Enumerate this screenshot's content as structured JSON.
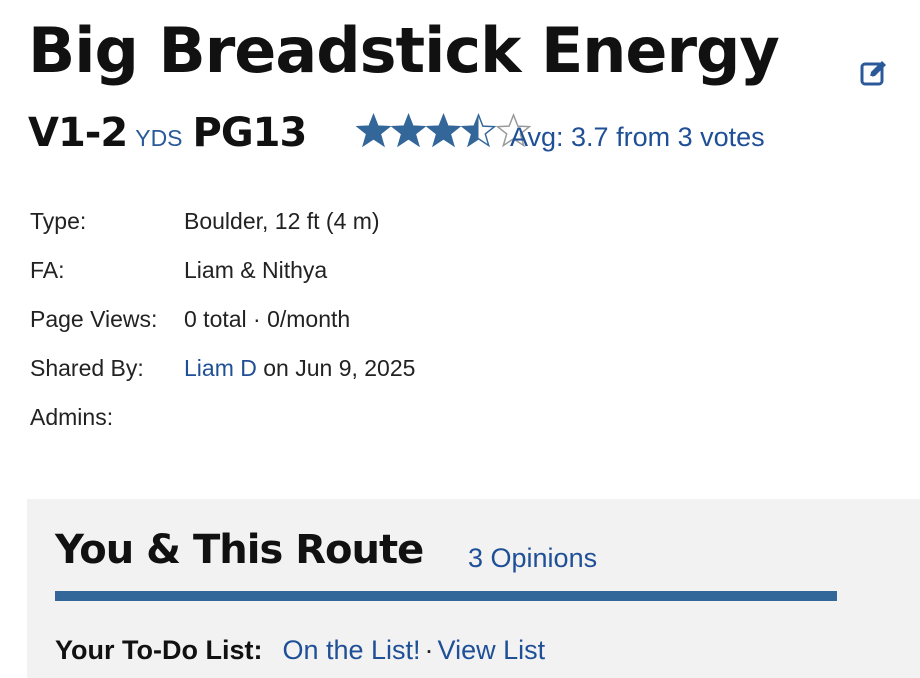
{
  "route": {
    "title": "Big Breadstick Energy",
    "grade": "V1-2",
    "grade_system": "YDS",
    "safety_rating": "PG13"
  },
  "rating": {
    "stars": 3.7,
    "max_stars": 5,
    "avg_text": "Avg: 3.7 from 3 votes",
    "star_color": "#336699"
  },
  "details": {
    "type_label": "Type:",
    "type_value": "Boulder, 12 ft (4 m)",
    "fa_label": "FA:",
    "fa_value": "Liam & Nithya",
    "views_label": "Page Views:",
    "views_value": "0 total · 0/month",
    "shared_label": "Shared By:",
    "shared_user": "Liam D",
    "shared_date": "on Jun 9, 2025",
    "admins_label": "Admins:"
  },
  "you_section": {
    "heading": "You & This Route",
    "opinions_link": "3 Opinions",
    "todo_label": "Your To-Do List:",
    "todo_status_link": "On the List!",
    "separator": "·",
    "view_list_link": "View List"
  },
  "icons": {
    "edit": "edit-icon"
  },
  "colors": {
    "link": "#1f4f96",
    "accent": "#336699",
    "section_bg": "#f2f2f2"
  }
}
